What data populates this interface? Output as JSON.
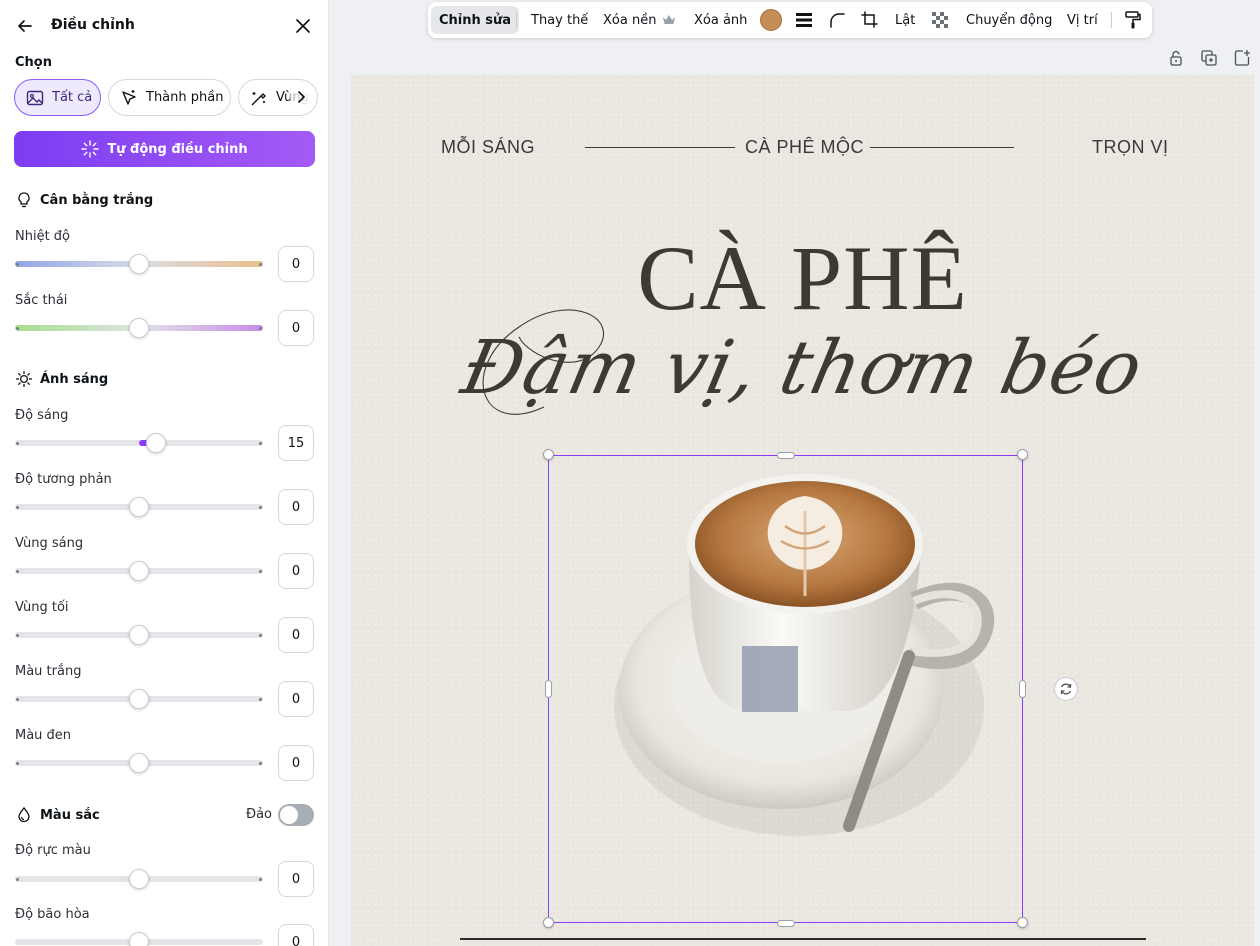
{
  "panel": {
    "title": "Điều chỉnh",
    "select_label": "Chọn",
    "chips": [
      "Tất cả",
      "Thành phần",
      "Vùng"
    ],
    "auto_button": "Tự động điều chỉnh",
    "white_balance": {
      "title": "Cân bằng trắng",
      "sliders": [
        {
          "label": "Nhiệt độ",
          "value": "0"
        },
        {
          "label": "Sắc thái",
          "value": "0"
        }
      ]
    },
    "light": {
      "title": "Ánh sáng",
      "sliders": [
        {
          "label": "Độ sáng",
          "value": "15"
        },
        {
          "label": "Độ tương phản",
          "value": "0"
        },
        {
          "label": "Vùng sáng",
          "value": "0"
        },
        {
          "label": "Vùng tối",
          "value": "0"
        },
        {
          "label": "Màu trắng",
          "value": "0"
        },
        {
          "label": "Màu đen",
          "value": "0"
        }
      ]
    },
    "color": {
      "title": "Màu sắc",
      "invert_label": "Đảo",
      "invert_on": false,
      "sliders": [
        {
          "label": "Độ rực màu",
          "value": "0"
        },
        {
          "label": "Độ bão hòa",
          "value": "0"
        }
      ]
    }
  },
  "toolbar": {
    "edit": "Chỉnh sửa",
    "replace": "Thay thế",
    "remove_bg": "Xóa nền",
    "delete_image": "Xóa ảnh",
    "flip": "Lật",
    "animate": "Chuyển động",
    "position": "Vị trí",
    "color_swatch": "#c58d58"
  },
  "canvas": {
    "top_left": "MỖI SÁNG",
    "top_center": "CÀ PHÊ MỘC",
    "top_right": "TRỌN VỊ",
    "headline": "CÀ PHÊ",
    "script": "Đậm vị, thơm béo"
  }
}
